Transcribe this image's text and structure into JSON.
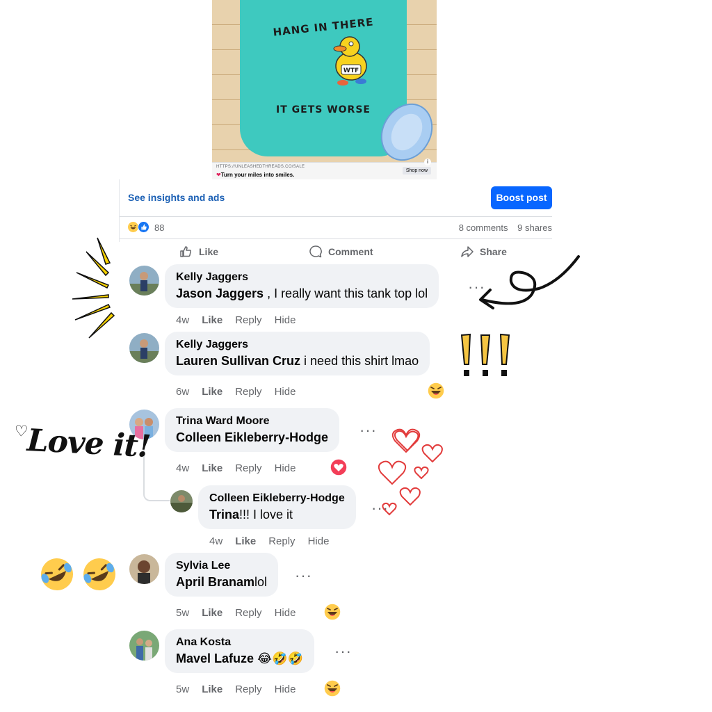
{
  "ad": {
    "shirt_top": "HANG IN THERE",
    "shirt_badge": "WTF",
    "shirt_bottom": "IT GETS WORSE",
    "url": "HTTPS://UNLEASHEDTHREADS.CO/SALE",
    "tagline": "Turn your miles into smiles.",
    "shop_button": "Shop now",
    "info": "i"
  },
  "post": {
    "insights_link": "See insights and ads",
    "boost_button": "Boost post",
    "reactions_count": "88",
    "comments_count": "8 comments",
    "shares_count": "9 shares",
    "actions": {
      "like": "Like",
      "comment": "Comment",
      "share": "Share"
    }
  },
  "comments": [
    {
      "author": "Kelly Jaggers",
      "mention": "Jason Jaggers",
      "text": " , I really want this tank top lol",
      "time": "4w",
      "like": "Like",
      "reply": "Reply",
      "hide": "Hide",
      "more": "···"
    },
    {
      "author": "Kelly Jaggers",
      "mention": "Lauren Sullivan Cruz",
      "text": " i need this shirt lmao",
      "time": "6w",
      "like": "Like",
      "reply": "Reply",
      "hide": "Hide",
      "reaction": "haha"
    },
    {
      "author": "Trina Ward Moore",
      "mention": "Colleen Eikleberry-Hodge",
      "text": "",
      "time": "4w",
      "like": "Like",
      "reply": "Reply",
      "hide": "Hide",
      "more": "···",
      "reaction": "love"
    },
    {
      "author": "Colleen Eikleberry-Hodge",
      "mention": "Trina",
      "text": "!!! I love it",
      "time": "4w",
      "like": "Like",
      "reply": "Reply",
      "hide": "Hide",
      "more": "···",
      "is_reply": true
    },
    {
      "author": "Sylvia Lee",
      "mention": "April Branam",
      "text": "lol",
      "time": "5w",
      "like": "Like",
      "reply": "Reply",
      "hide": "Hide",
      "more": "···",
      "reaction": "haha"
    },
    {
      "author": "Ana Kosta",
      "mention": "Mavel Lafuze",
      "text": " 😂🤣🤣",
      "time": "5w",
      "like": "Like",
      "reply": "Reply",
      "hide": "Hide",
      "more": "···",
      "reaction": "haha"
    }
  ],
  "decorations": {
    "love_text": "Love it!",
    "exclamations": "!!!"
  },
  "colors": {
    "link_blue": "#1a5fb4",
    "boost_blue": "#0866ff",
    "bubble_gray": "#f0f2f5",
    "meta_gray": "#65676b",
    "love_red": "#f33e58",
    "haha_yellow": "#ffcc4d",
    "shirt_teal": "#3ec9bf"
  }
}
